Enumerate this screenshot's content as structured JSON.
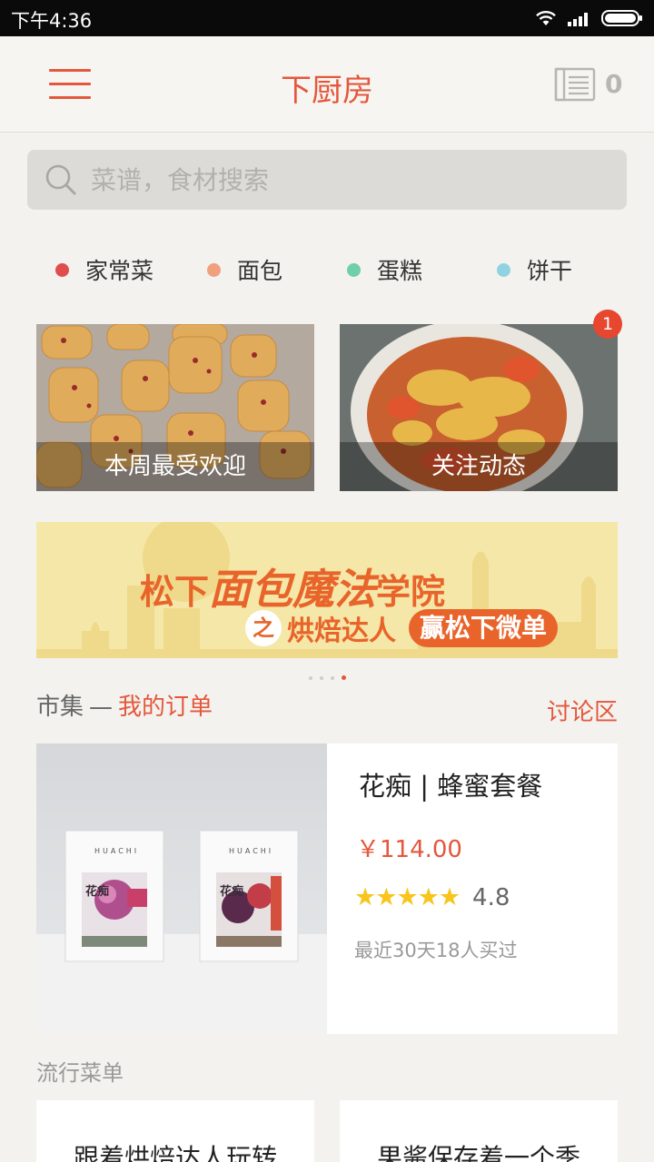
{
  "status_bar": {
    "time": "下午4:36"
  },
  "header": {
    "title": "下厨房",
    "cart_count": "0"
  },
  "search": {
    "placeholder": "菜谱，食材搜索"
  },
  "categories": [
    {
      "label": "家常菜",
      "color": "#e04d4d"
    },
    {
      "label": "面包",
      "color": "#f0a07e"
    },
    {
      "label": "蛋糕",
      "color": "#6fcfaa"
    },
    {
      "label": "饼干",
      "color": "#8fd3e2"
    }
  ],
  "features": [
    {
      "label": "本周最受欢迎"
    },
    {
      "label": "关注动态",
      "badge": "1"
    }
  ],
  "banner": {
    "line1_prefix": "松下",
    "line1_script": "面包魔法",
    "line1_suffix": "学院",
    "line2_zhi": "之",
    "line2_text": "烘焙达人",
    "line2_prize": "赢松下微单"
  },
  "market": {
    "title": "市集",
    "separator": "—",
    "my_orders": "我的订单",
    "discussion": "讨论区"
  },
  "product": {
    "title": "花痴 | 蜂蜜套餐",
    "price": "￥114.00",
    "stars": "★★★★★",
    "rating": "4.8",
    "sales": "最近30天18人买过",
    "box_brand": "HUACHI",
    "box_label": "花痴"
  },
  "popular": {
    "title": "流行菜单",
    "items": [
      {
        "label": "跟着烘焙达人玩转"
      },
      {
        "label": "果酱保存着一个季"
      }
    ]
  }
}
